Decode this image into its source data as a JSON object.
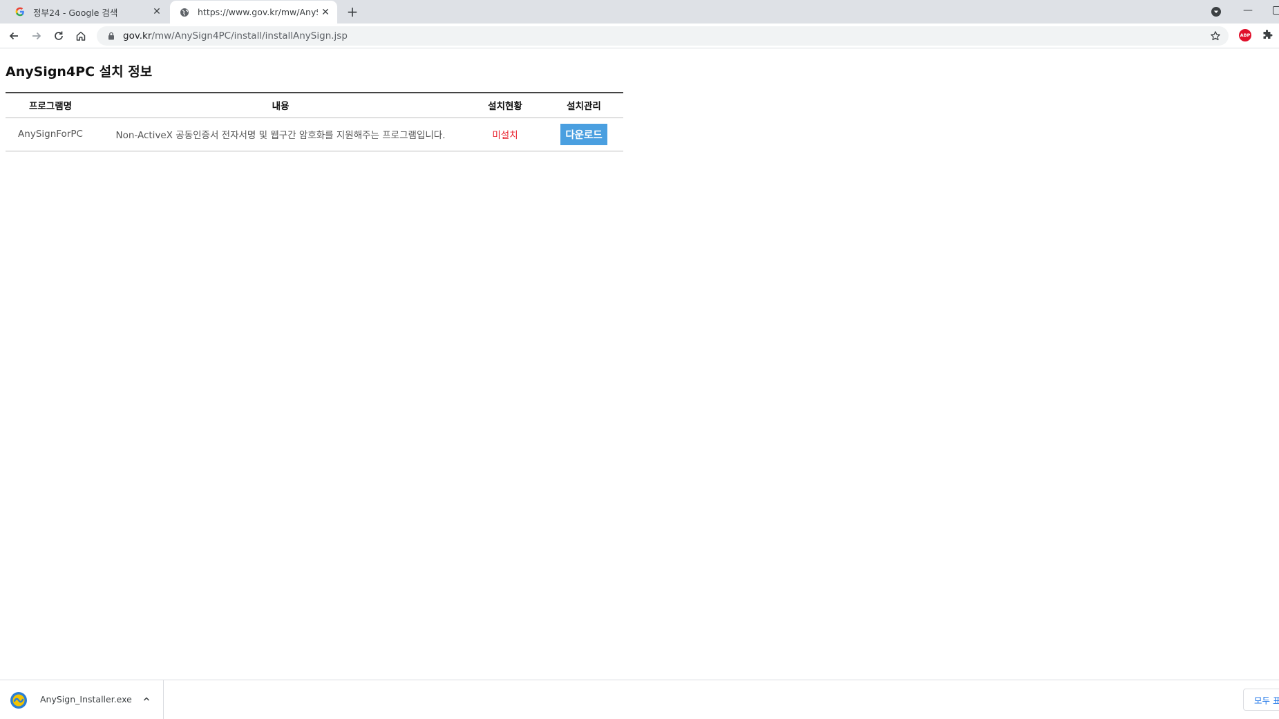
{
  "browser": {
    "tabs": [
      {
        "title": "정부24 - Google 검색",
        "favicon": "google-g-icon",
        "active": false
      },
      {
        "title": "https://www.gov.kr/mw/AnySign",
        "favicon": "globe-icon",
        "active": true
      }
    ],
    "url_host": "gov.kr",
    "url_path": "/mw/AnySign4PC/install/installAnySign.jsp",
    "extension_abp_label": "ABP"
  },
  "page": {
    "title": "AnySign4PC 설치 정보",
    "table": {
      "headers": {
        "program": "프로그램명",
        "content": "내용",
        "status": "설치현황",
        "manage": "설치관리"
      },
      "rows": [
        {
          "program": "AnySignForPC",
          "content": "Non-ActiveX 공동인증서 전자서명 및 웹구간 암호화를 지원해주는 프로그램입니다.",
          "status": "미설치",
          "action": "다운로드"
        }
      ]
    }
  },
  "downloads": {
    "file_name": "AnySign_Installer.exe",
    "show_all_label": "모두 표"
  },
  "colors": {
    "status_uninstalled": "#e8222d",
    "download_button": "#4a9fe0",
    "link_blue": "#1a73e8"
  }
}
